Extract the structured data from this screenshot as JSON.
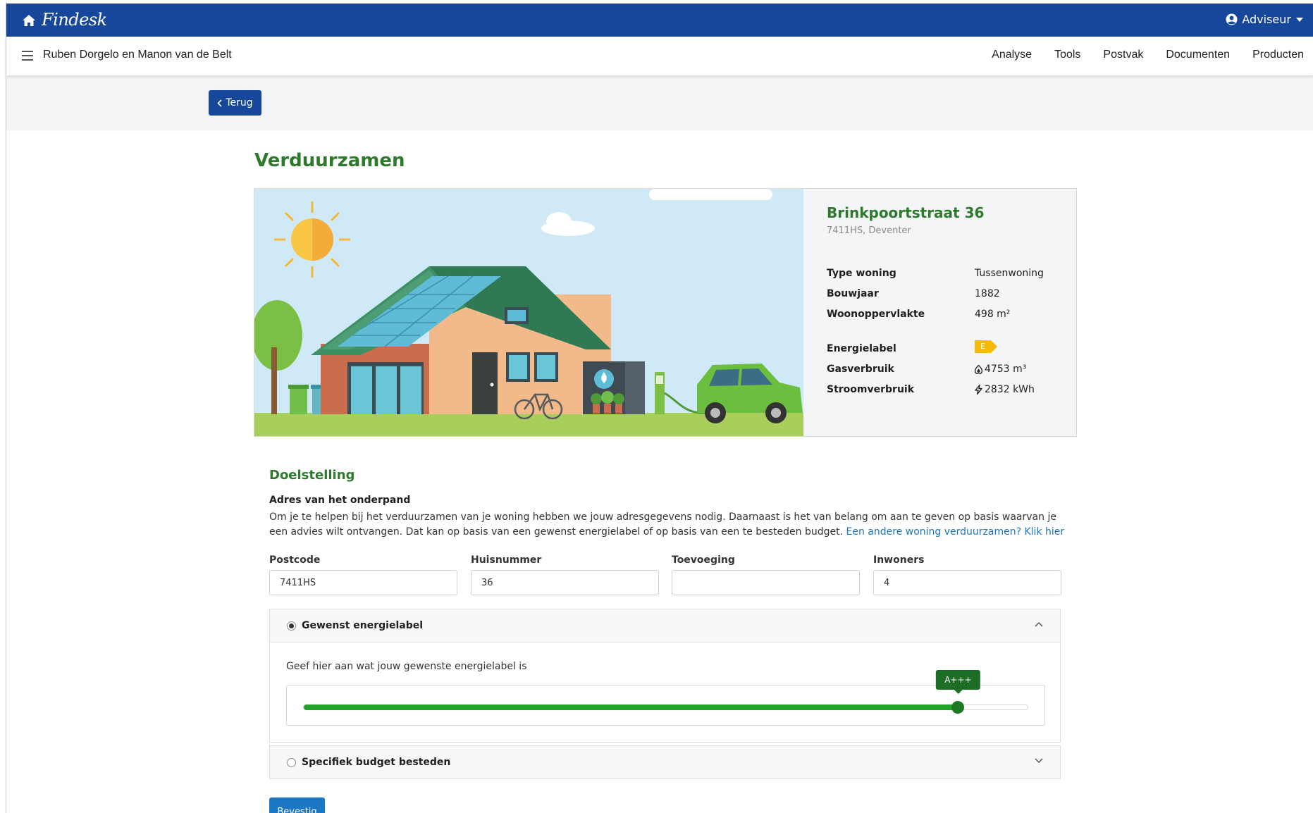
{
  "app": {
    "brand": "Findesk",
    "user_menu": "Adviseur"
  },
  "header": {
    "client_name": "Ruben Dorgelo en Manon van de Belt",
    "nav": [
      "Analyse",
      "Tools",
      "Postvak",
      "Documenten",
      "Producten"
    ]
  },
  "back_button": "Terug",
  "page_title": "Verduurzamen",
  "property": {
    "street": "Brinkpoortstraat 36",
    "city": "7411HS, Deventer",
    "details": [
      {
        "label": "Type woning",
        "value": "Tussenwoning"
      },
      {
        "label": "Bouwjaar",
        "value": "1882"
      },
      {
        "label": "Woonoppervlakte",
        "value": "498 m²"
      }
    ],
    "energy_label_title": "Energielabel",
    "energy_label_value": "E",
    "energy_label_color": "#f5b80d",
    "gas_title": "Gasverbruik",
    "gas_value": "4753 m³",
    "gas_icon": "flame-icon",
    "power_title": "Stroomverbruik",
    "power_value": "2832 kWh",
    "power_icon": "lightning-icon"
  },
  "doelstelling": {
    "title": "Doelstelling",
    "subtitle": "Adres van het onderpand",
    "description": "Om je te helpen bij het verduurzamen van je woning hebben we jouw adresgegevens nodig. Daarnaast is het van belang om aan te geven op basis waarvan je een advies wilt ontvangen. Dat kan op basis van een gewenst energielabel of op basis van een te besteden budget. ",
    "link_text": "Een andere woning verduurzamen? Klik hier"
  },
  "fields": {
    "postcode": {
      "label": "Postcode",
      "value": "7411HS"
    },
    "huisnummer": {
      "label": "Huisnummer",
      "value": "36"
    },
    "toevoeging": {
      "label": "Toevoeging",
      "value": ""
    },
    "inwoners": {
      "label": "Inwoners",
      "value": "4"
    }
  },
  "option_label": {
    "title": "Gewenst energielabel",
    "selected": true,
    "expanded": true,
    "hint": "Geef hier aan wat jouw gewenste energielabel is",
    "slider_value_label": "A+++",
    "slider_fraction": 0.904
  },
  "option_budget": {
    "title": "Specifiek budget besteden",
    "selected": false,
    "expanded": false
  },
  "confirm_button": "Bevestig",
  "colors": {
    "primary_blue": "#17479a",
    "accent_green": "#2d7a2d",
    "link_blue": "#1b76c4",
    "slider_green": "#24a22b"
  }
}
